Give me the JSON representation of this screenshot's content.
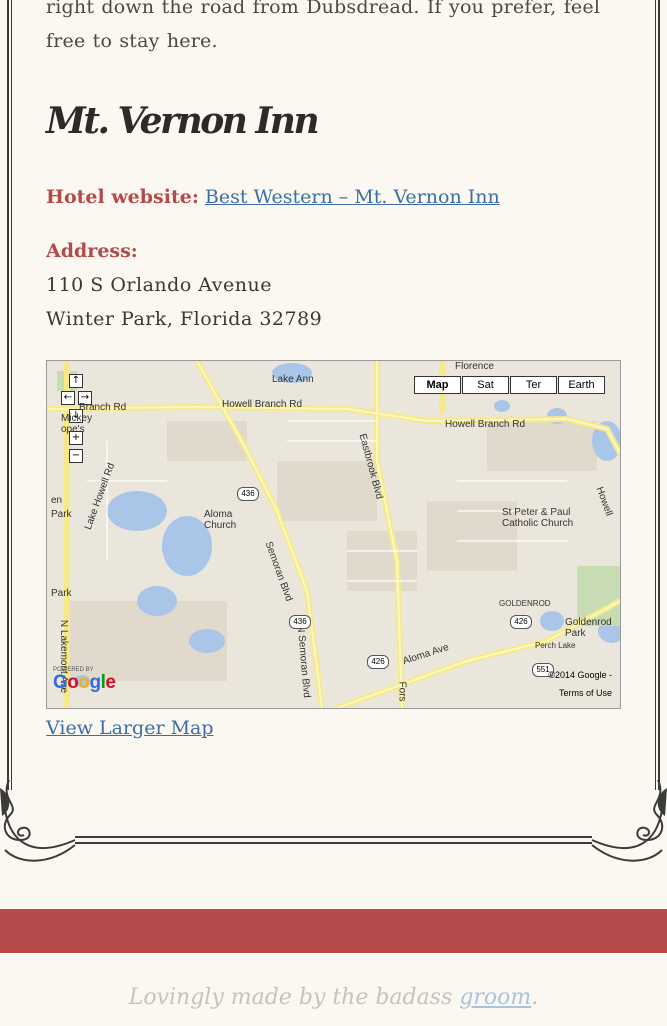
{
  "intro": {
    "text": "right down the road from Dubsdread. If you prefer, feel free to stay here."
  },
  "inn": {
    "title": "Mt. Vernon Inn",
    "website_label": "Hotel website:",
    "website_link": "Best Western – Mt. Vernon Inn",
    "address_label": "Address:",
    "address_line1": "110 S Orlando Avenue",
    "address_line2": "Winter Park, Florida 32789"
  },
  "map": {
    "types": [
      "Map",
      "Sat",
      "Ter",
      "Earth"
    ],
    "active_type": "Map",
    "labels": {
      "florence": "Florence",
      "lake_ann": "Lake Ann",
      "howell_branch_w": "Howell Branch Rd",
      "howell_branch_c": "Howell Branch Rd",
      "howell_branch_e": "Howell Branch Rd",
      "howell": "Howell",
      "eastbrook": "Eastbrook Blvd",
      "lake_howell": "Lake Howell Rd",
      "aloma_church": "Aloma\nChurch",
      "semoran": "Semoran Blvd",
      "st_peter": "St Peter & Paul\nCatholic Church",
      "goldenrod": "GOLDENROD",
      "goldenrod_park": "Goldenrod\nPark",
      "perch_lake": "Perch Lake",
      "aloma_ave": "Aloma Ave",
      "n_semoran": "N Semoran Blvd",
      "n_lakemont": "N Lakemont Ave",
      "forsyth": "Fors",
      "park": "Park",
      "en_park": "en\nPark",
      "mckey": "Mickey\nope's",
      "branch_rd": "Branch Rd"
    },
    "shields": [
      "436",
      "436",
      "426",
      "426",
      "551"
    ],
    "powered_by": "POWERED BY",
    "google": "Google",
    "copyright": "©2014 Google -",
    "terms": "Terms of Use"
  },
  "view_larger_map": "View Larger Map",
  "footer": {
    "prefix": "Lovingly made by the badass ",
    "link": "groom",
    "suffix": "."
  },
  "colors": {
    "accent_red": "#b54b4b",
    "link_blue": "#3b6ea5",
    "background": "#fbf8f1"
  }
}
